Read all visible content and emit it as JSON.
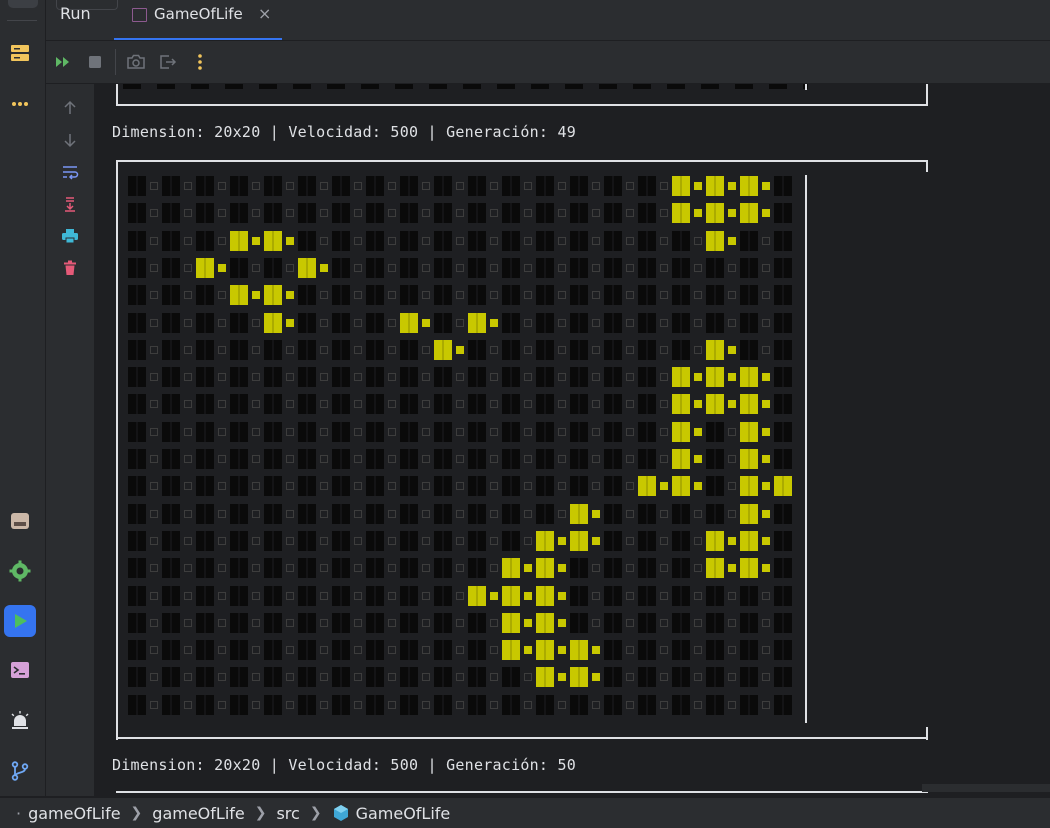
{
  "window": {
    "tabs": [
      {
        "label": "Run"
      },
      {
        "label": "GameOfLife",
        "close": "×"
      }
    ]
  },
  "left_strip": {
    "icons": [
      "structure-icon",
      "more-icon",
      "services-icon",
      "settings-icon",
      "run-icon",
      "terminal-icon",
      "problems-icon",
      "git-icon"
    ]
  },
  "toolbar": {
    "icons": [
      "rerun-icon",
      "stop-icon",
      "screenshot-icon",
      "exit-icon",
      "more-vertical-icon"
    ]
  },
  "gutter": {
    "icons": [
      "scroll-up-icon",
      "scroll-down-icon",
      "soft-wrap-icon",
      "scroll-to-end-icon",
      "print-icon",
      "clear-icon"
    ]
  },
  "console": {
    "status_49": "Dimension: 20x20 | Velocidad: 500 | Generación: 49",
    "status_50": "Dimension: 20x20 | Velocidad: 500 | Generación: 50",
    "grid_size": 20,
    "live_cells": [
      [
        0,
        16
      ],
      [
        0,
        17
      ],
      [
        0,
        18
      ],
      [
        1,
        16
      ],
      [
        1,
        17
      ],
      [
        1,
        18
      ],
      [
        2,
        3
      ],
      [
        2,
        4
      ],
      [
        2,
        17
      ],
      [
        3,
        2
      ],
      [
        3,
        5
      ],
      [
        4,
        3
      ],
      [
        4,
        4
      ],
      [
        5,
        4
      ],
      [
        5,
        8
      ],
      [
        5,
        10
      ],
      [
        6,
        9
      ],
      [
        6,
        17
      ],
      [
        7,
        16
      ],
      [
        7,
        17
      ],
      [
        7,
        18
      ],
      [
        8,
        16
      ],
      [
        8,
        17
      ],
      [
        8,
        18
      ],
      [
        9,
        16
      ],
      [
        9,
        18
      ],
      [
        10,
        16
      ],
      [
        10,
        18
      ],
      [
        11,
        15
      ],
      [
        11,
        16
      ],
      [
        11,
        18
      ],
      [
        11,
        19
      ],
      [
        12,
        13
      ],
      [
        12,
        18
      ],
      [
        13,
        12
      ],
      [
        13,
        13
      ],
      [
        13,
        17
      ],
      [
        13,
        18
      ],
      [
        14,
        11
      ],
      [
        14,
        12
      ],
      [
        14,
        17
      ],
      [
        14,
        18
      ],
      [
        15,
        10
      ],
      [
        15,
        11
      ],
      [
        15,
        12
      ],
      [
        16,
        11
      ],
      [
        16,
        12
      ],
      [
        17,
        11
      ],
      [
        17,
        12
      ],
      [
        17,
        13
      ],
      [
        18,
        12
      ],
      [
        18,
        13
      ]
    ],
    "colors": {
      "live": "#c8c800",
      "live_dark": "#8e8e00",
      "dead": "#0a0a0a",
      "dead_outline": "#3d3d3d",
      "text": "#dfe1e5"
    }
  },
  "breadcrumb": {
    "items": [
      "gameOfLife",
      "gameOfLife",
      "src",
      "GameOfLife"
    ]
  }
}
